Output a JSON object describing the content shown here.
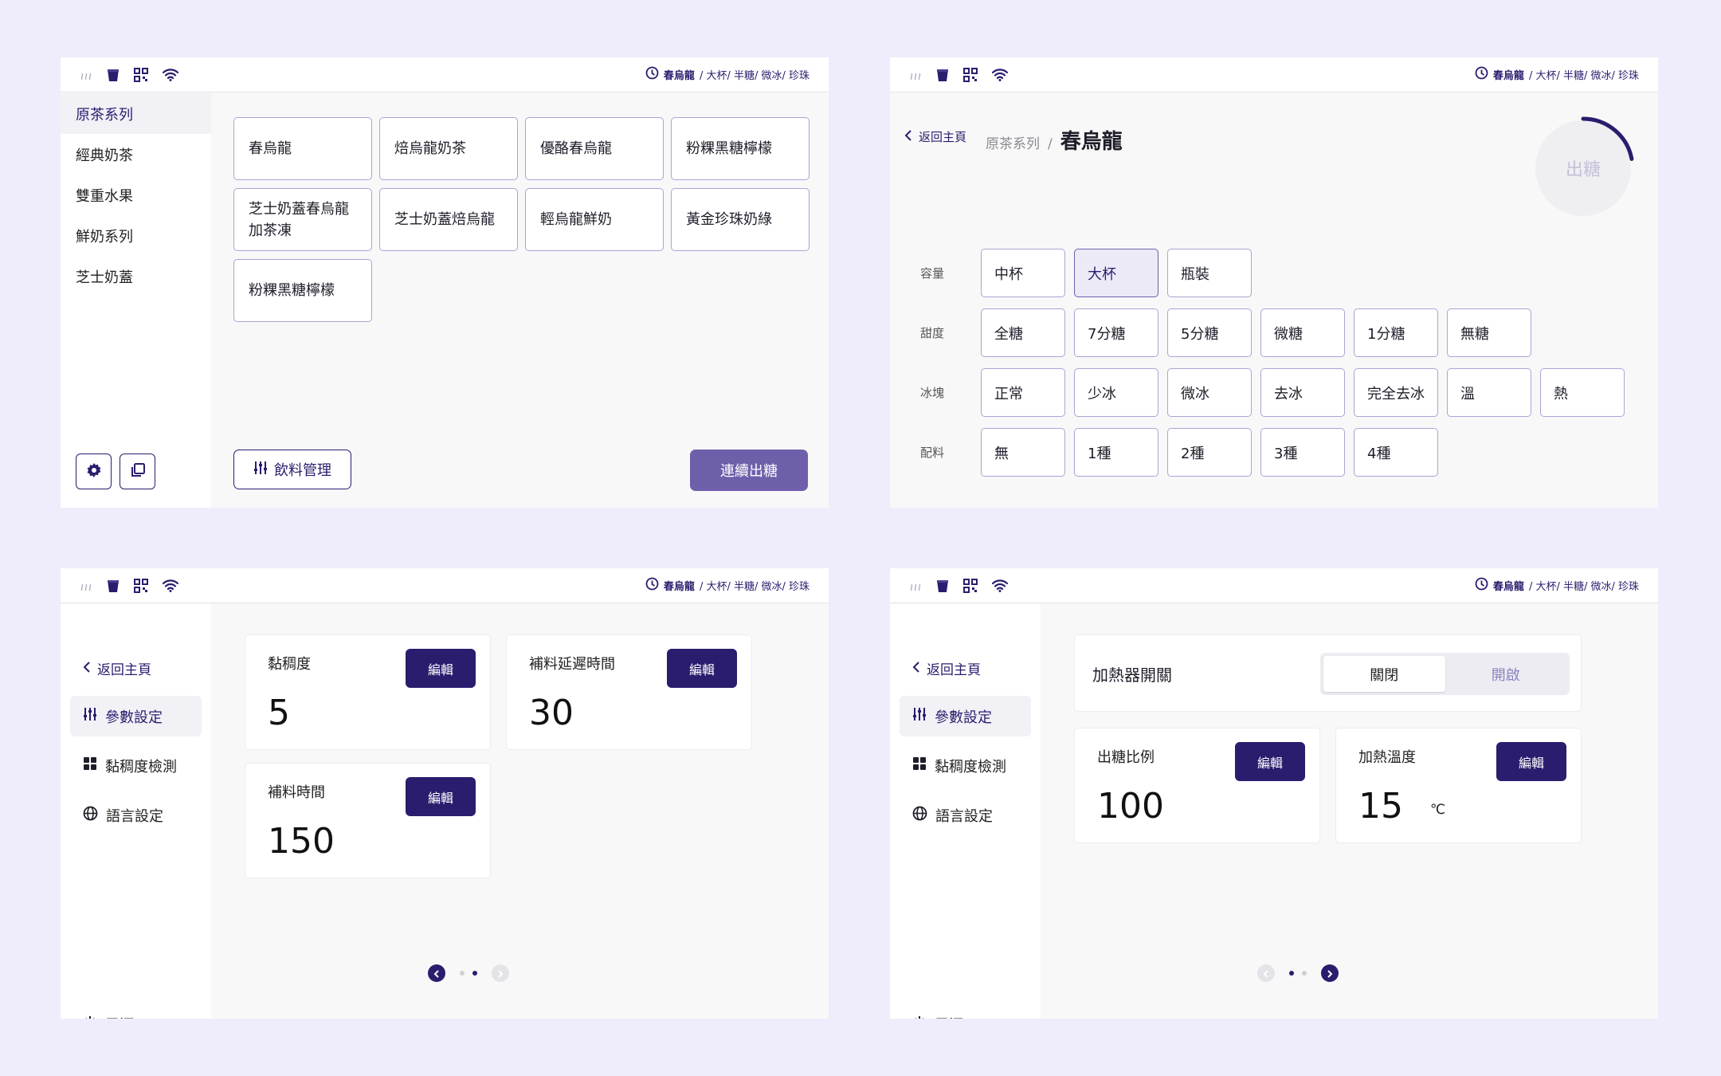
{
  "colors": {
    "background": "#efedfb",
    "primary": "#2a1d6e",
    "accent_button": "#6f5fab",
    "card_border": "#aaa4d3",
    "selected_bg": "#eceaf6"
  },
  "status": {
    "icons": [
      "steam-icon",
      "cup-icon",
      "qr-code-icon",
      "wifi-icon"
    ],
    "order_icon": "history-icon",
    "order_name": "春烏龍",
    "order_details": "/ 大杯/ 半糖/ 微冰/ 珍珠"
  },
  "menu": {
    "categories": [
      {
        "label": "原茶系列"
      },
      {
        "label": "經典奶茶"
      },
      {
        "label": "雙重水果"
      },
      {
        "label": "鮮奶系列"
      },
      {
        "label": "芝士奶蓋"
      }
    ],
    "active_category": "原茶系列",
    "products": [
      {
        "name": "春烏龍"
      },
      {
        "name": "焙烏龍奶茶"
      },
      {
        "name": "優酪春烏龍"
      },
      {
        "name": "粉粿黑糖檸檬"
      },
      {
        "name": "芝士奶蓋春烏龍\n加茶凍"
      },
      {
        "name": "芝士奶蓋焙烏龍"
      },
      {
        "name": "輕烏龍鮮奶"
      },
      {
        "name": "黃金珍珠奶綠"
      },
      {
        "name": "粉粿黑糖檸檬"
      }
    ],
    "manage_label": "飲料管理",
    "continuous_label": "連續出糖"
  },
  "detail": {
    "back_label": "返回主頁",
    "breadcrumb_category": "原茶系列",
    "breadcrumb_sep": "/",
    "product_name": "春烏龍",
    "dispense_label": "出糖",
    "dispense_progress": 0.22,
    "options": [
      {
        "label": "容量",
        "choices": [
          "中杯",
          "大杯",
          "瓶裝"
        ],
        "selected": 1
      },
      {
        "label": "甜度",
        "choices": [
          "全糖",
          "7分糖",
          "5分糖",
          "微糖",
          "1分糖",
          "無糖"
        ],
        "selected": -1
      },
      {
        "label": "冰塊",
        "choices": [
          "正常",
          "少冰",
          "微冰",
          "去冰",
          "完全去冰",
          "溫",
          "熱"
        ],
        "selected": -1
      },
      {
        "label": "配料",
        "choices": [
          "無",
          "1種",
          "2種",
          "3種",
          "4種"
        ],
        "selected": -1
      }
    ]
  },
  "settings": {
    "back_label": "返回主頁",
    "nav": [
      {
        "label": "參數設定",
        "icon": "sliders-icon"
      },
      {
        "label": "黏稠度檢測",
        "icon": "grid-icon"
      },
      {
        "label": "語言設定",
        "icon": "globe-icon"
      }
    ],
    "power_label": "電源",
    "edit_label": "編輯",
    "page1": {
      "params": [
        {
          "label": "黏稠度",
          "value": "5"
        },
        {
          "label": "補料延遲時間",
          "value": "30"
        },
        {
          "label": "補料時間",
          "value": "150"
        }
      ],
      "page": 2,
      "pages": 2
    },
    "page2": {
      "heater_label": "加熱器開關",
      "heater_off": "關閉",
      "heater_on": "開啟",
      "params": [
        {
          "label": "出糖比例",
          "value": "100",
          "unit": ""
        },
        {
          "label": "加熱溫度",
          "value": "15",
          "unit": "℃"
        }
      ],
      "page": 1,
      "pages": 2
    }
  }
}
